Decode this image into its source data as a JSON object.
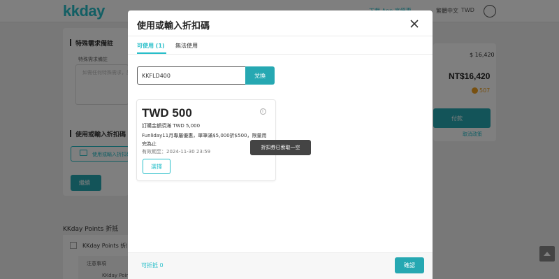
{
  "brand": {
    "logo": "kkday",
    "accent": "#26bec9",
    "button": "#26a8b2"
  },
  "topnav": {
    "app_link": "下載 App 享優惠",
    "language": "繁體中文",
    "currency": "TWD"
  },
  "background": {
    "special_requests_title": "特殊需求備註",
    "special_requests_label": "特殊需求備註",
    "special_requests_placeholder": "如需任何特殊需求，請填寫",
    "coupon_section_title": "使用或輸入折扣碼",
    "coupon_link": "使用或輸入折扣碼",
    "continue_button": "繼續",
    "price_small": "$ 16,420",
    "price_total": "NT$16,420",
    "points_earned": "507",
    "pay_button": "付款",
    "cancel_policy": "取消政策",
    "points_section_title": "KKday Points 折抵",
    "points_checkbox_label": "KKday Points 折抵",
    "notice_label": "注意事項",
    "notice_item": "KKday Points"
  },
  "modal": {
    "title": "使用或輸入折扣碼",
    "tabs": {
      "usable": "可使用 (1)",
      "unusable": "無法使用"
    },
    "code_input_value": "KKFLD400",
    "exchange_button": "兌換",
    "coupon": {
      "amount": "TWD 500",
      "min_spend": "訂購金額須滿 TWD 5,000",
      "description": "Funliday11月專屬優惠，單筆滿$5,000折$500，限量用完為止",
      "expiry": "有效期至：2024-11-30 23:59",
      "select_button": "選擇"
    },
    "tooltip": "折扣券已索取一空",
    "footer": {
      "discount_label": "可折抵 0",
      "confirm_button": "確認"
    }
  }
}
